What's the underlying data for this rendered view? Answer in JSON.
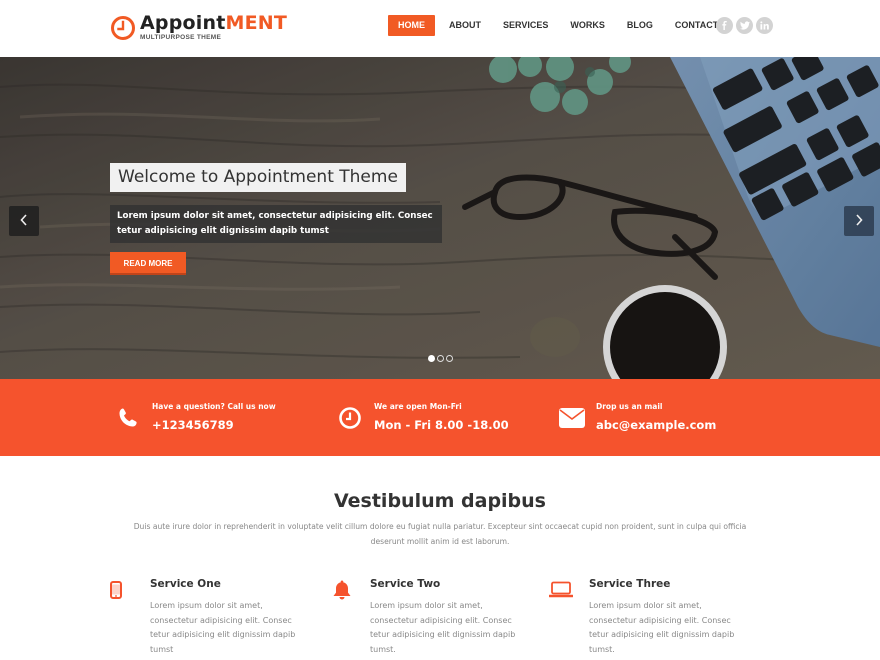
{
  "header": {
    "logo": {
      "name_main": "Appoint",
      "name_accent": "ment",
      "tagline": "MULTIPURPOSE THEME",
      "icon": "clock-icon"
    },
    "nav": [
      {
        "label": "HOME",
        "active": true
      },
      {
        "label": "ABOUT",
        "active": false
      },
      {
        "label": "SERVICES",
        "active": false
      },
      {
        "label": "WORKS",
        "active": false
      },
      {
        "label": "BLOG",
        "active": false
      },
      {
        "label": "CONTACT",
        "active": false
      }
    ],
    "social": [
      {
        "name": "facebook",
        "icon": "facebook-icon"
      },
      {
        "name": "twitter",
        "icon": "twitter-icon"
      },
      {
        "name": "linkedin",
        "icon": "linkedin-icon"
      }
    ]
  },
  "hero": {
    "title": "Welcome to Appointment Theme",
    "text": "Lorem ipsum dolor sit amet, consectetur adipisicing elit. Consec tetur adipisicing elit dignissim dapib tumst",
    "button_label": "READ MORE",
    "prev_icon": "chevron-left-icon",
    "next_icon": "chevron-right-icon",
    "slides_total": 3,
    "active_slide": 1
  },
  "contact_strip": [
    {
      "icon": "phone-icon",
      "label": "Have a question? Call us now",
      "value": "+123456789"
    },
    {
      "icon": "clock-icon",
      "label": "We are open Mon-Fri",
      "value": "Mon - Fri 8.00 -18.00"
    },
    {
      "icon": "envelope-icon",
      "label": "Drop us an mail",
      "value": "abc@example.com"
    }
  ],
  "services_section": {
    "title": "Vestibulum dapibus",
    "description": "Duis aute irure dolor in reprehenderit in voluptate velit cillum dolore eu fugiat nulla pariatur. Excepteur sint occaecat cupid non proident, sunt in culpa qui officia deserunt mollit anim id est laborum.",
    "items": [
      {
        "icon": "mobile-phone-icon",
        "title": "Service One",
        "text": "Lorem ipsum dolor sit amet, consectetur adipisicing elit. Consec tetur adipisicing elit dignissim dapib tumst"
      },
      {
        "icon": "bell-icon",
        "title": "Service Two",
        "text": "Lorem ipsum dolor sit amet, consectetur adipisicing elit. Consec tetur adipisicing elit dignissim dapib tumst."
      },
      {
        "icon": "laptop-icon",
        "title": "Service Three",
        "text": "Lorem ipsum dolor sit amet, consectetur adipisicing elit. Consec tetur adipisicing elit dignissim dapib tumst."
      }
    ]
  },
  "colors": {
    "accent": "#f15a24",
    "strip": "#f5532d",
    "social_icons": "#d3d3d3"
  }
}
